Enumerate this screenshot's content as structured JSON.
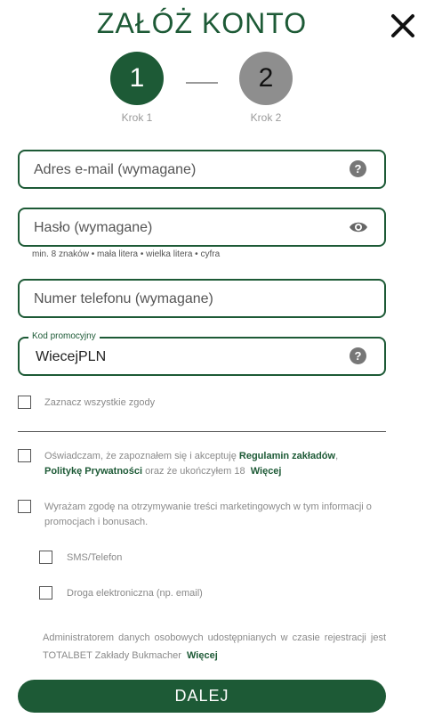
{
  "header": {
    "title": "ZAŁÓŻ KONTO"
  },
  "steps": [
    {
      "number": "1",
      "label": "Krok 1"
    },
    {
      "number": "2",
      "label": "Krok 2"
    }
  ],
  "form": {
    "email_placeholder": "Adres e-mail (wymagane)",
    "password_placeholder": "Hasło (wymagane)",
    "password_hint": "min. 8 znaków • mała litera • wielka litera • cyfra",
    "phone_placeholder": "Numer telefonu (wymagane)",
    "promo_label": "Kod promocyjny",
    "promo_value": "WiecejPLN"
  },
  "consents": {
    "select_all": "Zaznacz wszystkie zgody",
    "terms_prefix": "Oświadczam, że zapoznałem się i akceptuję",
    "terms_link": "Regulamin zakładów",
    "terms_comma": ",",
    "privacy_link": "Politykę Prywatności",
    "terms_suffix": "oraz że ukończyłem 18",
    "more": "Więcej",
    "marketing": "Wyrażam zgodę na otrzymywanie treści marketingowych w tym informacji o promocjach i bonusach.",
    "sms": "SMS/Telefon",
    "email": "Droga elektroniczna (np. email)"
  },
  "admin_note": {
    "text": "Administratorem danych osobowych udostępnianych w czasie rejestracji jest TOTALBET Zakłady Bukmacher",
    "more": "Więcej"
  },
  "actions": {
    "next": "DALEJ"
  },
  "colors": {
    "accent": "#1d5a36",
    "inactive_step": "#8e8e8e"
  },
  "icons": [
    "close-icon",
    "help-icon",
    "eye-icon"
  ]
}
